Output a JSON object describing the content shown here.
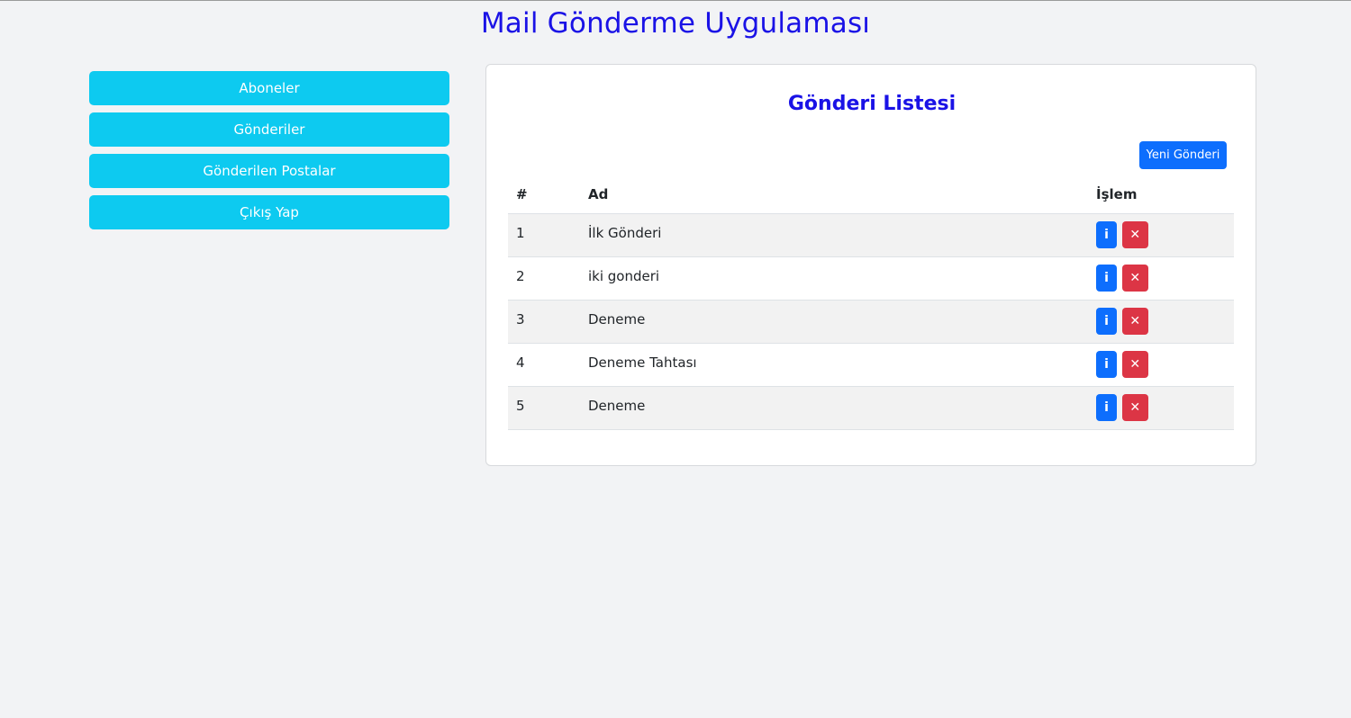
{
  "app_title": "Mail Gönderme Uygulaması",
  "sidebar": {
    "items": [
      {
        "label": "Aboneler"
      },
      {
        "label": "Gönderiler"
      },
      {
        "label": "Gönderilen Postalar"
      },
      {
        "label": "Çıkış Yap"
      }
    ]
  },
  "card": {
    "title": "Gönderi Listesi",
    "new_button": "Yeni Gönderi",
    "columns": {
      "num": "#",
      "name": "Ad",
      "action": "İşlem"
    },
    "rows": [
      {
        "num": "1",
        "name": "İlk Gönderi"
      },
      {
        "num": "2",
        "name": "iki gonderi"
      },
      {
        "num": "3",
        "name": "Deneme"
      },
      {
        "num": "4",
        "name": "Deneme Tahtası"
      },
      {
        "num": "5",
        "name": "Deneme"
      }
    ],
    "info_glyph": "i",
    "delete_glyph": "✕"
  },
  "colors": {
    "title": "#1a12e6",
    "sidebar_button": "#0dcaf0",
    "primary": "#0d6efd",
    "danger": "#dc3545"
  },
  "icons": {
    "info": "info-icon",
    "delete": "close-icon"
  }
}
